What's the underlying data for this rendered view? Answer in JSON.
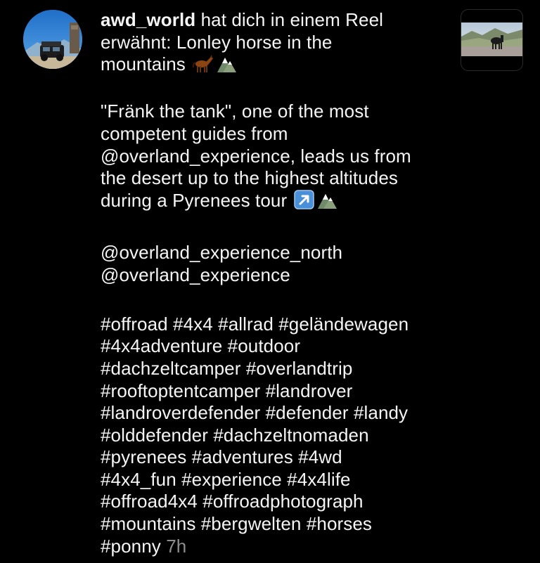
{
  "notification": {
    "username": "awd_world",
    "mention_text_line1": " hat dich in einem Reel",
    "mention_text_line2": "erwähnt: Lonley horse in the",
    "mention_text_line3": "mountains",
    "caption_line1": "\"Fränk the tank\", one of the most",
    "caption_line2": "competent guides from",
    "caption_line3": "@overland_experience, leads us from",
    "caption_line4": "the desert up to the highest altitudes",
    "caption_line5": "during a Pyrenees tour",
    "mention_1": "@overland_experience_north",
    "mention_2": "@overland_experience",
    "hashtags": [
      "#offroad #4x4 #allrad #geländewagen",
      "#4x4adventure #outdoor",
      "#dachzeltcamper #overlandtrip",
      "#rooftoptentcamper #landrover",
      "#landroverdefender #defender #landy",
      "#olddefender #dachzeltnomaden",
      "#pyrenees #adventures #4wd",
      "#4x4_fun #experience #4x4life",
      "#offroad4x4 #offroadphotograph",
      "#mountains #bergwelten #horses"
    ],
    "last_hashtag": "#ponny",
    "time": "7h",
    "icons": {
      "horse": "horse-emoji",
      "mountain": "mountain-emoji",
      "arrow": "up-right-arrow-emoji"
    }
  }
}
